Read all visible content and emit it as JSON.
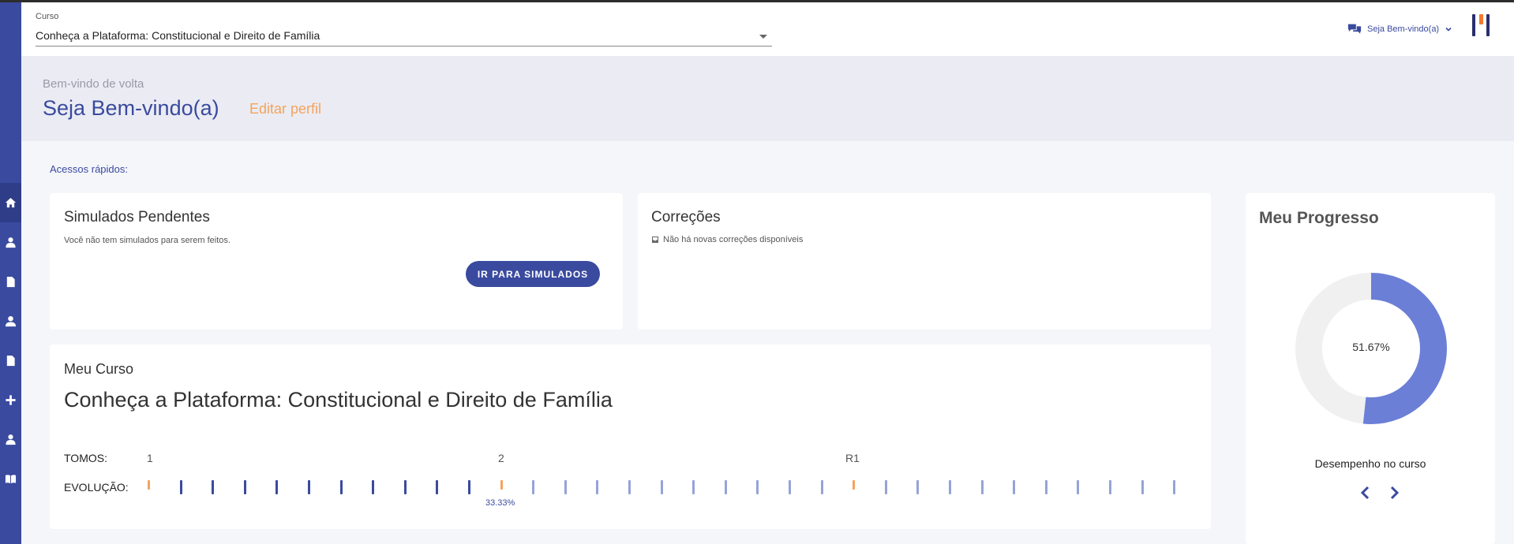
{
  "header": {
    "course_label": "Curso",
    "course_selected": "Conheça a Plataforma: Constitucional e Direito de Família",
    "user_menu_label": "Seja Bem-vindo(a)"
  },
  "sidebar": {
    "items": [
      {
        "icon": "home-icon"
      },
      {
        "icon": "user-tie-icon"
      },
      {
        "icon": "document-icon"
      },
      {
        "icon": "user-icon"
      },
      {
        "icon": "document-icon"
      },
      {
        "icon": "plus-icon"
      },
      {
        "icon": "user-tie-icon"
      },
      {
        "icon": "book-icon"
      }
    ]
  },
  "welcome": {
    "subtitle": "Bem-vindo de volta",
    "title": "Seja Bem-vindo(a)",
    "edit_profile": "Editar perfil"
  },
  "quick_access_label": "Acessos rápidos:",
  "simulados": {
    "title": "Simulados Pendentes",
    "message": "Você não tem simulados para serem feitos.",
    "button": "IR PARA SIMULADOS"
  },
  "correcoes": {
    "title": "Correções",
    "message": "Não há novas correções disponíveis"
  },
  "meu_curso": {
    "label": "Meu Curso",
    "title": "Conheça a Plataforma: Constitucional e Direito de Família",
    "tomos_label": "TOMOS:",
    "evolucao_label": "EVOLUÇÃO:",
    "tomos": [
      "1",
      "2",
      "R1"
    ],
    "progress_text": "33.33%",
    "progress_fraction": 0.3333
  },
  "progresso": {
    "title": "Meu Progresso",
    "percent_text": "51.67%",
    "percent_value": 51.67,
    "performance_label": "Desempenho no curso"
  },
  "colors": {
    "primary": "#3a4a9f",
    "accent": "#f5a35c",
    "donut_fill": "#6b7fd7",
    "donut_track": "#f0f0f0"
  }
}
